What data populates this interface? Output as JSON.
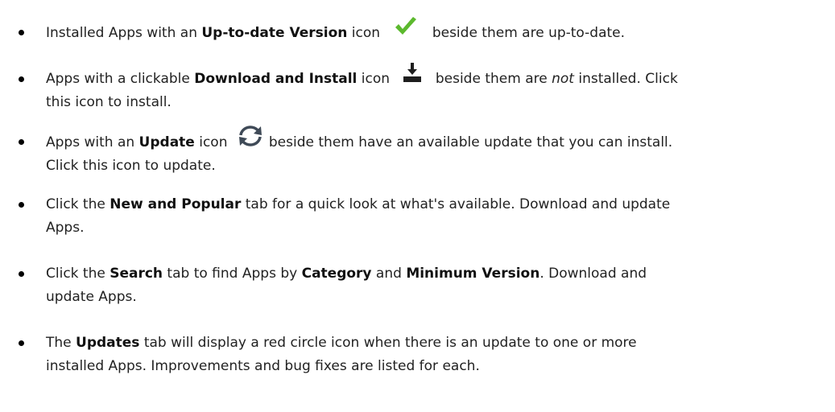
{
  "bullets": [
    {
      "t1": "Installed Apps with an ",
      "b1": "Up-to-date Version",
      "t2": " icon",
      "icon": "green-check-icon",
      "t3": "beside them are up-to-date."
    },
    {
      "t1": "Apps with a clickable ",
      "b1": "Download and Install",
      "t2": " icon",
      "icon": "download-install-icon",
      "t3": "beside them are ",
      "i1": "not",
      "t4": " installed. Click",
      "line2": "this icon to install."
    },
    {
      "t1": "Apps with an ",
      "b1": "Update",
      "t2": " icon",
      "icon": "refresh-update-icon",
      "t3": "beside them have an available update that you can install.",
      "line2": "Click this icon to update."
    },
    {
      "t1": "Click the ",
      "b1": "New and Popular",
      "t2": " tab for a quick look at what's available. Download and update",
      "line2": "Apps."
    },
    {
      "t1": "Click the ",
      "b1": "Search",
      "t2": " tab to find Apps by ",
      "b2": "Category",
      "t3": " and ",
      "b3": "Minimum Version",
      "t4": ". Download and",
      "line2": "update Apps."
    },
    {
      "t1": "The ",
      "b1": "Updates",
      "t2": " tab will display a red circle icon when there is an update to one or more",
      "line2": "installed Apps. Improvements and bug fixes are listed for each."
    }
  ],
  "colors": {
    "check": "#5cb92e",
    "download": "#1e1e1e",
    "update": "#3f4a57",
    "text": "#222222"
  }
}
